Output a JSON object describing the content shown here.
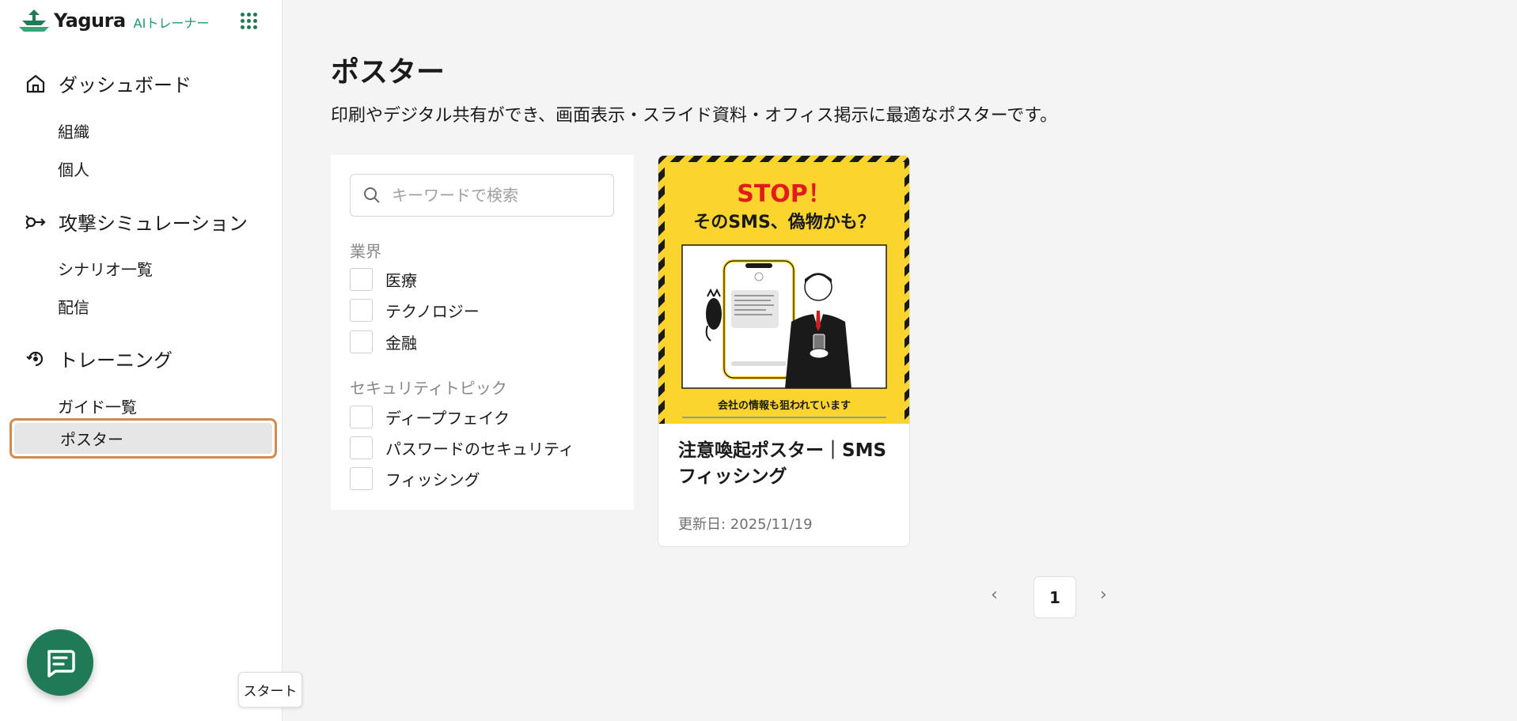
{
  "brand": {
    "name": "Yagura",
    "sub": "AIトレーナー"
  },
  "sidebar": {
    "sections": [
      {
        "label": "ダッシュボード",
        "icon": "home-icon",
        "items": [
          "組織",
          "個人"
        ]
      },
      {
        "label": "攻撃シミュレーション",
        "icon": "simulation-icon",
        "items": [
          "シナリオ一覧",
          "配信"
        ]
      },
      {
        "label": "トレーニング",
        "icon": "training-icon",
        "items": [
          "ガイド一覧",
          "ポスター"
        ]
      }
    ],
    "active_item": "ポスター"
  },
  "page": {
    "title": "ポスター",
    "description": "印刷やデジタル共有ができ、画面表示・スライド資料・オフィス掲示に最適なポスターです。"
  },
  "filters": {
    "search_placeholder": "キーワードで検索",
    "groups": [
      {
        "title": "業界",
        "options": [
          "医療",
          "テクノロジー",
          "金融"
        ]
      },
      {
        "title": "セキュリティトピック",
        "options": [
          "ディープフェイク",
          "パスワードのセキュリティ",
          "フィッシング"
        ]
      }
    ]
  },
  "cards": [
    {
      "title": "注意喚起ポスター｜SMSフィッシング",
      "date": "更新日: 2025/11/19",
      "poster": {
        "headline": "STOP！",
        "subhead": "そのSMS、偽物かも？",
        "footer": "会社の情報も狙われています"
      }
    }
  ],
  "pagination": {
    "current": "1",
    "prev": "‹",
    "next": "›"
  },
  "floating": {
    "start_label": "スタート"
  },
  "colors": {
    "accent": "#1f7a56",
    "highlight": "#d38a4f",
    "poster_yellow": "#fbd52e",
    "stop_red": "#e01b1b"
  }
}
